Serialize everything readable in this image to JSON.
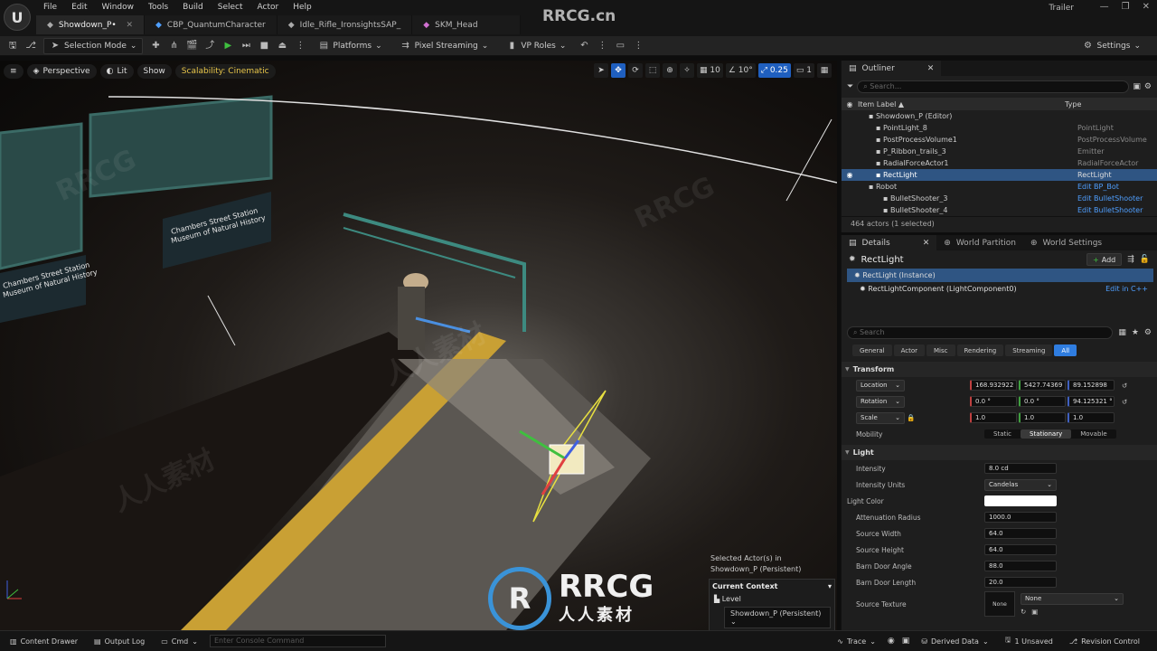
{
  "window": {
    "logo_glyph": "U",
    "menu": [
      "File",
      "Edit",
      "Window",
      "Tools",
      "Build",
      "Select",
      "Actor",
      "Help"
    ],
    "tabs": [
      {
        "label": "Showdown_P•",
        "icon": "level-icon",
        "active": true
      },
      {
        "label": "CBP_QuantumCharacter",
        "icon": "blueprint-icon",
        "active": false
      },
      {
        "label": "Idle_Rifle_IronsightsSAP_",
        "icon": "animation-icon",
        "active": false
      },
      {
        "label": "SKM_Head",
        "icon": "skeletal-mesh-icon",
        "active": false
      }
    ],
    "project_name": "Trailer",
    "watermark_top": "RRCG.cn"
  },
  "toolbar": {
    "selection_mode": "Selection Mode",
    "platforms": "Platforms",
    "pixel_streaming": "Pixel Streaming",
    "vp_roles": "VP Roles",
    "settings": "Settings"
  },
  "viewport": {
    "perspective": "Perspective",
    "lit": "Lit",
    "show": "Show",
    "scalability": "Scalability: Cinematic",
    "grid_snap": "10",
    "rot_snap": "10°",
    "scale_snap": "0.25",
    "camera_speed": "1",
    "selected_actors_label": "Selected Actor(s) in",
    "selected_level": "Showdown_P (Persistent)",
    "current_context": "Current Context",
    "level_label": "Level",
    "level_value": "Showdown_P (Persistent)",
    "brand_text": "RRCG",
    "brand_sub": "人人素材",
    "sign_text_1": "Chambers Street Station",
    "sign_text_2": "Museum of Natural History"
  },
  "outliner": {
    "tab": "Outliner",
    "search_placeholder": "Search...",
    "col_label": "Item Label ▲",
    "col_type": "Type",
    "rows": [
      {
        "label": "Showdown_P (Editor)",
        "type": "",
        "indent": 30,
        "icon": "level-icon"
      },
      {
        "label": "PointLight_8",
        "type": "PointLight",
        "indent": 38,
        "icon": "point-light-icon"
      },
      {
        "label": "PostProcessVolume1",
        "type": "PostProcessVolume",
        "indent": 38,
        "icon": "volume-icon"
      },
      {
        "label": "P_Ribbon_trails_3",
        "type": "Emitter",
        "indent": 38,
        "icon": "emitter-icon"
      },
      {
        "label": "RadialForceActor1",
        "type": "RadialForceActor",
        "indent": 38,
        "icon": "force-icon"
      },
      {
        "label": "RectLight",
        "type": "RectLight",
        "indent": 38,
        "icon": "rect-light-icon",
        "selected": true
      },
      {
        "label": "Robot",
        "type": "Edit BP_Bot",
        "indent": 30,
        "icon": "actor-icon",
        "link": true
      },
      {
        "label": "BulletShooter_3",
        "type": "Edit BulletShooter",
        "indent": 46,
        "icon": "actor-icon",
        "link": true
      },
      {
        "label": "BulletShooter_4",
        "type": "Edit BulletShooter",
        "indent": 46,
        "icon": "actor-icon",
        "link": true
      }
    ],
    "footer": "464 actors (1 selected)"
  },
  "details": {
    "tabs": [
      "Details",
      "World Partition",
      "World Settings"
    ],
    "title": "RectLight",
    "add_label": "Add",
    "instance": "RectLight (Instance)",
    "component": "RectLightComponent (LightComponent0)",
    "edit_cpp": "Edit in C++",
    "search_placeholder": "Search",
    "filters": [
      "General",
      "Actor",
      "Misc",
      "Rendering",
      "Streaming",
      "All"
    ],
    "transform_header": "Transform",
    "location_label": "Location",
    "location": [
      "168.932922",
      "5427.74369",
      "89.152898"
    ],
    "rotation_label": "Rotation",
    "rotation": [
      "0.0 °",
      "0.0 °",
      "94.125321 °"
    ],
    "scale_label": "Scale",
    "scale": [
      "1.0",
      "1.0",
      "1.0"
    ],
    "mobility_label": "Mobility",
    "mobility": [
      "Static",
      "Stationary",
      "Movable"
    ],
    "light_header": "Light",
    "props": [
      {
        "label": "Intensity",
        "value": "8.0 cd"
      },
      {
        "label": "Intensity Units",
        "value": "Candelas",
        "dropdown": true
      },
      {
        "label": "Light Color",
        "value": "",
        "color": true
      },
      {
        "label": "Attenuation Radius",
        "value": "1000.0"
      },
      {
        "label": "Source Width",
        "value": "64.0"
      },
      {
        "label": "Source Height",
        "value": "64.0"
      },
      {
        "label": "Barn Door Angle",
        "value": "88.0"
      },
      {
        "label": "Barn Door Length",
        "value": "20.0"
      }
    ],
    "source_texture_label": "Source Texture",
    "source_texture_value": "None",
    "source_texture_thumb": "None"
  },
  "statusbar": {
    "content_drawer": "Content Drawer",
    "output_log": "Output Log",
    "cmd": "Cmd",
    "console_placeholder": "Enter Console Command",
    "trace": "Trace",
    "derived_data": "Derived Data",
    "unsaved": "1 Unsaved",
    "revision_control": "Revision Control"
  },
  "colors": {
    "accent": "#2f7de0",
    "selection": "#2f5583",
    "link": "#4f9fff",
    "play": "#3fbf3f",
    "scalability": "#e8c64a"
  }
}
